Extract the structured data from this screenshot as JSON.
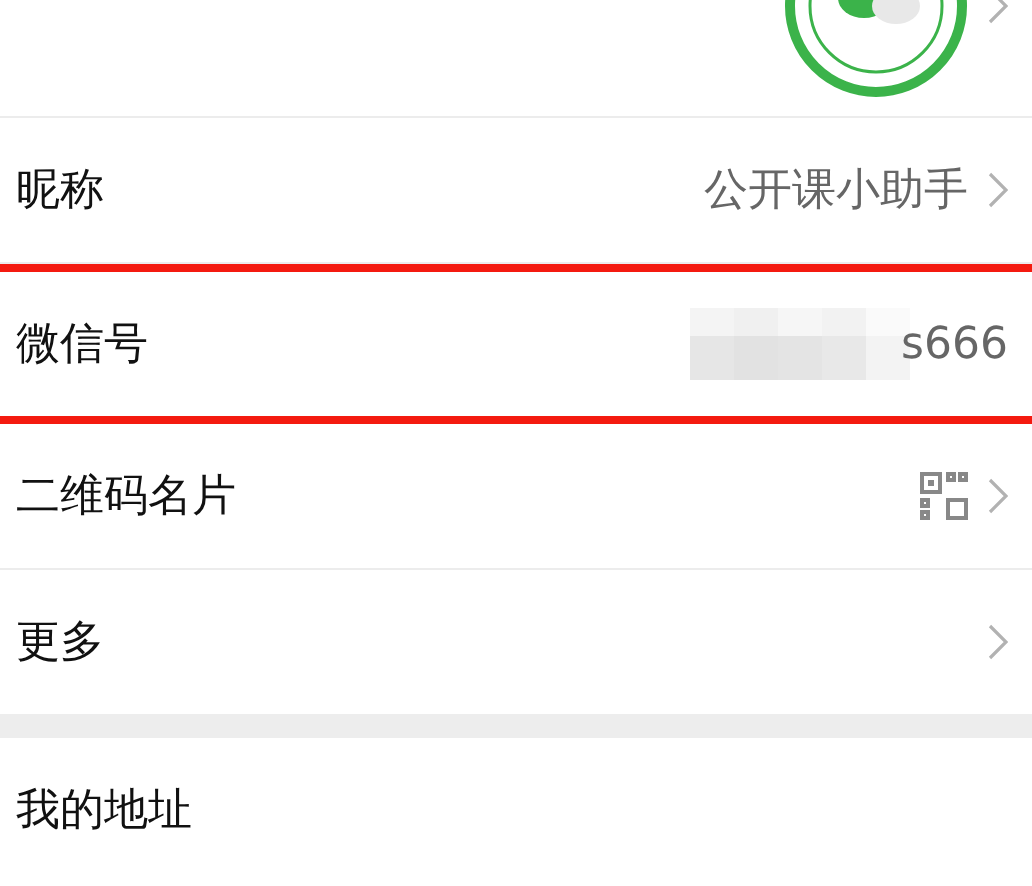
{
  "groups": [
    {
      "rows": [
        {
          "kind": "avatar",
          "chevron": true,
          "highlighted": false
        },
        {
          "kind": "text",
          "label": "昵称",
          "value": "公开课小助手",
          "chevron": true,
          "highlighted": false
        },
        {
          "kind": "text",
          "label": "微信号",
          "value": "s666",
          "masked": true,
          "chevron": false,
          "highlighted": true
        },
        {
          "kind": "qrcode",
          "label": "二维码名片",
          "chevron": true,
          "highlighted": false
        },
        {
          "kind": "text",
          "label": "更多",
          "chevron": true,
          "highlighted": false
        }
      ]
    },
    {
      "rows": [
        {
          "kind": "text",
          "label": "我的地址",
          "chevron": false,
          "highlighted": false
        }
      ]
    }
  ]
}
